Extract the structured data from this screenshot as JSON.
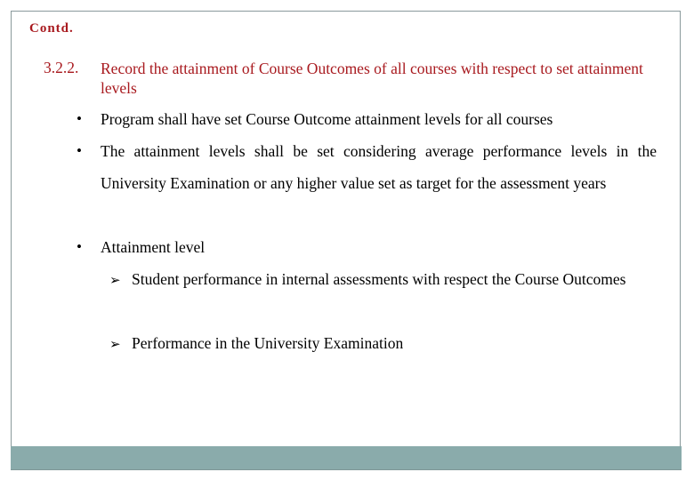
{
  "slide": {
    "continued_label": "Contd.",
    "section_number": "3.2.2.",
    "section_title": "Record the attainment of Course Outcomes of all courses with respect to set attainment levels",
    "bullets": [
      {
        "text": "Program shall have set Course Outcome attainment levels for all courses"
      },
      {
        "text": "The attainment levels shall be set considering average performance levels in the University Examination or any higher value set as target for the assessment years"
      },
      {
        "text": "Attainment level"
      }
    ],
    "sub_bullets": [
      {
        "text": "Student performance in internal assessments with respect the Course Outcomes"
      },
      {
        "text": "Performance in the University Examination"
      }
    ],
    "icons": {
      "bullet": "•",
      "arrow": "➢"
    },
    "colors": {
      "heading": "#a8191e",
      "band": "#8aabab",
      "border": "#8a9a9c"
    }
  }
}
